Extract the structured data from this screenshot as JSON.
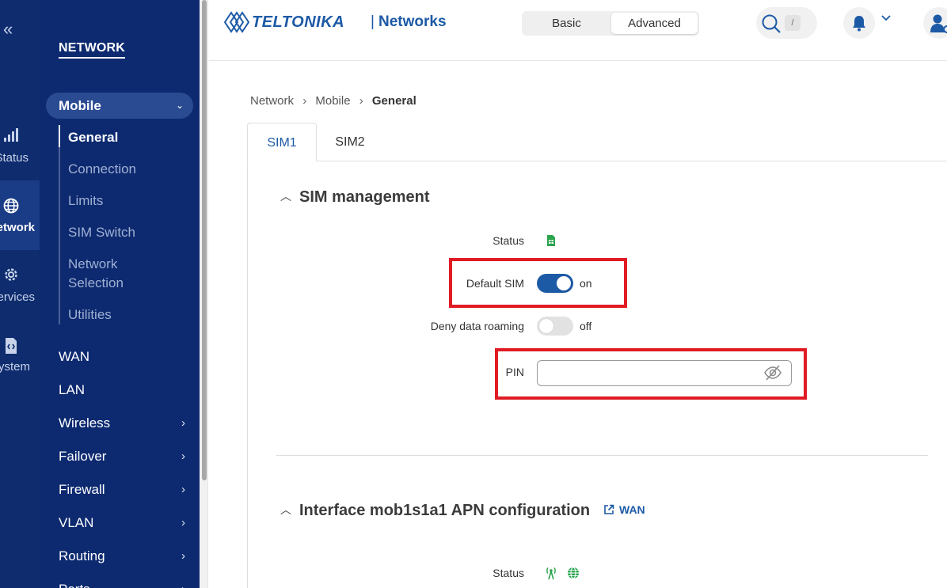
{
  "rail": {
    "items": [
      {
        "label": "Status",
        "icon": "signal-icon"
      },
      {
        "label": "Network",
        "icon": "globe-icon"
      },
      {
        "label": "Services",
        "icon": "gear-icon"
      },
      {
        "label": "System",
        "icon": "system-icon"
      }
    ],
    "active": "Network"
  },
  "sidebar": {
    "heading": "NETWORK",
    "mobile": "Mobile",
    "mobile_subitems": [
      "General",
      "Connection",
      "Limits",
      "SIM Switch",
      "Network Selection",
      "Utilities"
    ],
    "network_selection_line1": "Network",
    "network_selection_line2": "Selection",
    "items": [
      {
        "label": "WAN",
        "has_submenu": false
      },
      {
        "label": "LAN",
        "has_submenu": false
      },
      {
        "label": "Wireless",
        "has_submenu": true
      },
      {
        "label": "Failover",
        "has_submenu": true
      },
      {
        "label": "Firewall",
        "has_submenu": true
      },
      {
        "label": "VLAN",
        "has_submenu": true
      },
      {
        "label": "Routing",
        "has_submenu": true
      },
      {
        "label": "Ports",
        "has_submenu": true
      }
    ]
  },
  "header": {
    "brand": "TELTONIKA",
    "separator": "|",
    "product": "Networks",
    "mode_basic": "Basic",
    "mode_advanced": "Advanced",
    "active_mode": "Advanced",
    "search_shortcut": "/"
  },
  "breadcrumb": {
    "items": [
      "Network",
      "Mobile",
      "General"
    ],
    "separator": "›"
  },
  "tabs": [
    "SIM1",
    "SIM2"
  ],
  "active_tab": "SIM1",
  "sim_management": {
    "title": "SIM management",
    "status_label": "Status",
    "default_sim_label": "Default SIM",
    "default_sim_state": "on",
    "deny_roaming_label": "Deny data roaming",
    "deny_roaming_state": "off",
    "pin_label": "PIN",
    "pin_value": ""
  },
  "apn_section": {
    "title": "Interface mob1s1a1 APN configuration",
    "link_label": "WAN",
    "status_label": "Status"
  },
  "colors": {
    "sidebar_bg": "#0d2a70",
    "accent": "#1d5aa6",
    "status_green": "#2aa44f",
    "highlight_red": "#e01b24"
  }
}
